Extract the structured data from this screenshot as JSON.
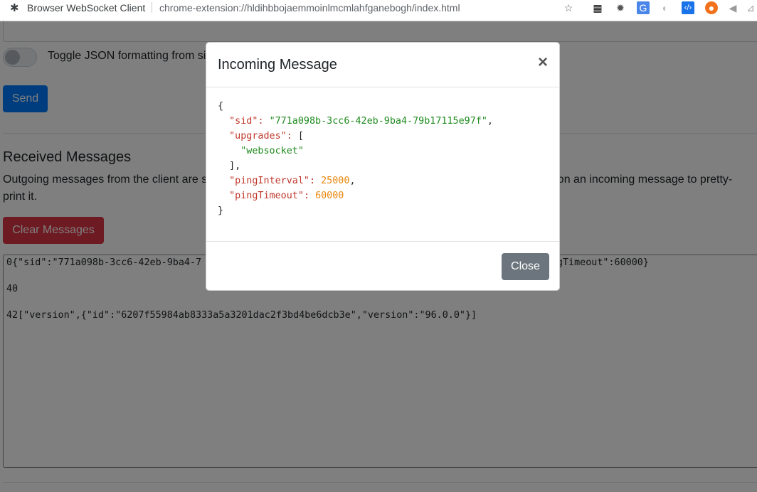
{
  "browser": {
    "app_name": "Browser WebSocket Client",
    "url": "chrome-extension://hldihbbojaemmoinlmcmlahfganebogh/index.html"
  },
  "page": {
    "toggle_label": "Toggle JSON formatting from si",
    "send_label": "Send",
    "received_heading": "Received Messages",
    "description": "Outgoing messages from the client are s                                                                                                 Click on on an incoming message to pretty-print it.",
    "clear_label": "Clear Messages",
    "messages": [
      "0{\"sid\":\"771a098b-3cc6-42eb-9ba4-7                                                          \"pingTimeout\":60000}",
      "40",
      "42[\"version\",{\"id\":\"6207f55984ab8333a5a3201dac2f3bd4be6dcb3e\",\"version\":\"96.0.0\"}]"
    ]
  },
  "modal": {
    "title": "Incoming Message",
    "close_x": "×",
    "close_label": "Close",
    "json": {
      "open": "{",
      "sid_key": "\"sid\"",
      "sid_val": "\"771a098b-3cc6-42eb-9ba4-79b17115e97f\"",
      "upgrades_key": "\"upgrades\"",
      "upgrades_open": "[",
      "upgrades_item": "\"websocket\"",
      "upgrades_close": "],",
      "ping_interval_key": "\"pingInterval\"",
      "ping_interval_val": "25000",
      "ping_timeout_key": "\"pingTimeout\"",
      "ping_timeout_val": "60000",
      "close": "}"
    }
  }
}
